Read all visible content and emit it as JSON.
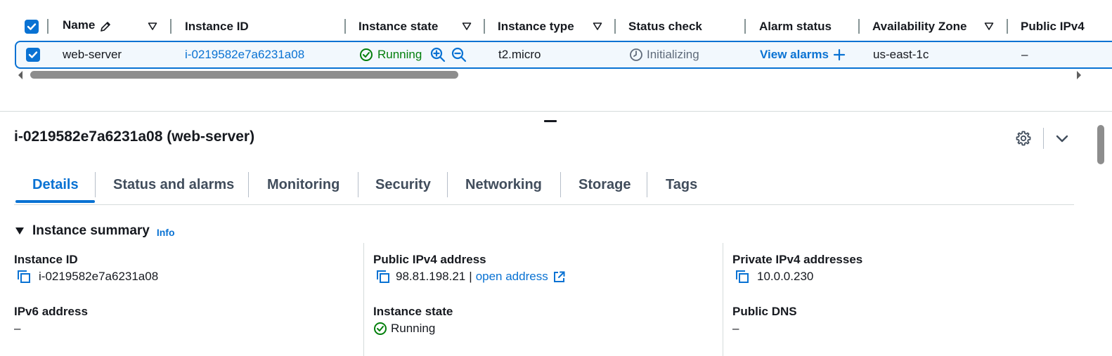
{
  "table": {
    "headers": {
      "name": "Name",
      "instance_id": "Instance ID",
      "instance_state": "Instance state",
      "instance_type": "Instance type",
      "status_check": "Status check",
      "alarm_status": "Alarm status",
      "availability_zone": "Availability Zone",
      "public_ipv4": "Public IPv4"
    },
    "row": {
      "name": "web-server",
      "instance_id": "i-0219582e7a6231a08",
      "instance_state": "Running",
      "instance_type": "t2.micro",
      "status_check": "Initializing",
      "alarm_status": "View alarms",
      "availability_zone": "us-east-1c",
      "public_ipv4": "–"
    }
  },
  "details": {
    "title": "i-0219582e7a6231a08 (web-server)",
    "tabs": [
      "Details",
      "Status and alarms",
      "Monitoring",
      "Security",
      "Networking",
      "Storage",
      "Tags"
    ],
    "active_tab": "Details",
    "section": {
      "title": "Instance summary",
      "info": "Info"
    },
    "fields": {
      "instance_id_label": "Instance ID",
      "instance_id_value": "i-0219582e7a6231a08",
      "public_ipv4_label": "Public IPv4 address",
      "public_ipv4_value": "98.81.198.21",
      "public_ipv4_sep": "|",
      "open_address": "open address",
      "private_ipv4_label": "Private IPv4 addresses",
      "private_ipv4_value": "10.0.0.230",
      "ipv6_label": "IPv6 address",
      "ipv6_value": "–",
      "instance_state_label": "Instance state",
      "instance_state_value": "Running",
      "public_dns_label": "Public DNS",
      "public_dns_value": "–"
    }
  },
  "colors": {
    "accent": "#0972d3",
    "running": "#037f0c",
    "text": "#16191f",
    "muted": "#5f6b7a"
  },
  "icons": [
    "checkbox-checked-icon",
    "pencil-icon",
    "sort-triangle-icon",
    "check-circle-icon",
    "zoom-in-icon",
    "zoom-out-icon",
    "clock-icon",
    "plus-icon",
    "copy-icon",
    "external-link-icon",
    "gear-icon",
    "chevron-down-icon",
    "caret-down-icon"
  ]
}
